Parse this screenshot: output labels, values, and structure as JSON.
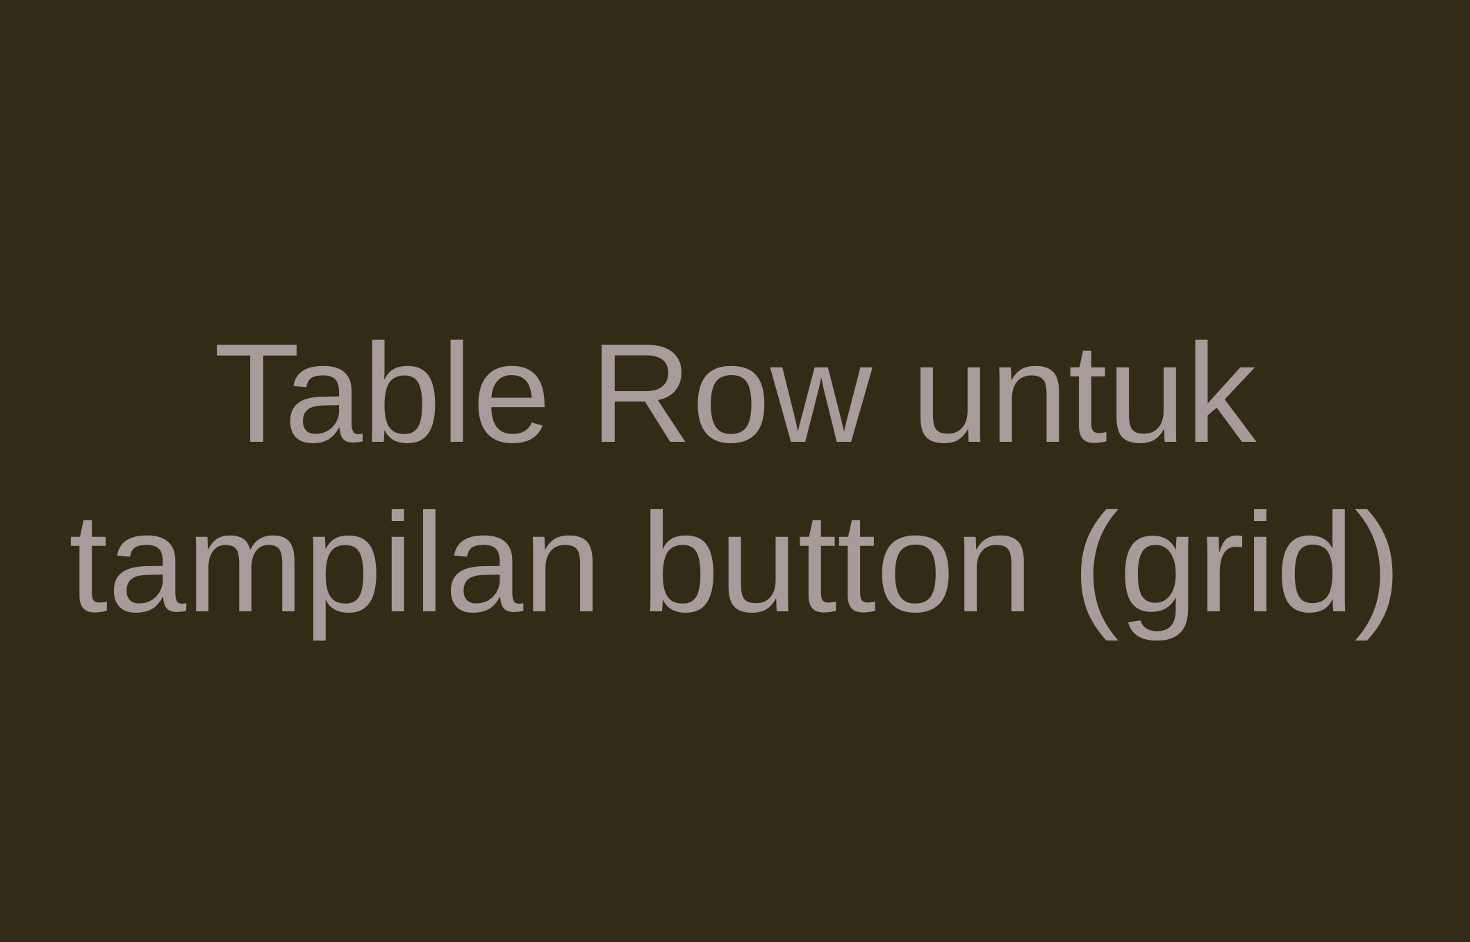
{
  "background_color": "#322b15",
  "text_color": "#a79b9b",
  "title": {
    "line1": "Table Row untuk",
    "line2": "tampilan button (grid)"
  }
}
